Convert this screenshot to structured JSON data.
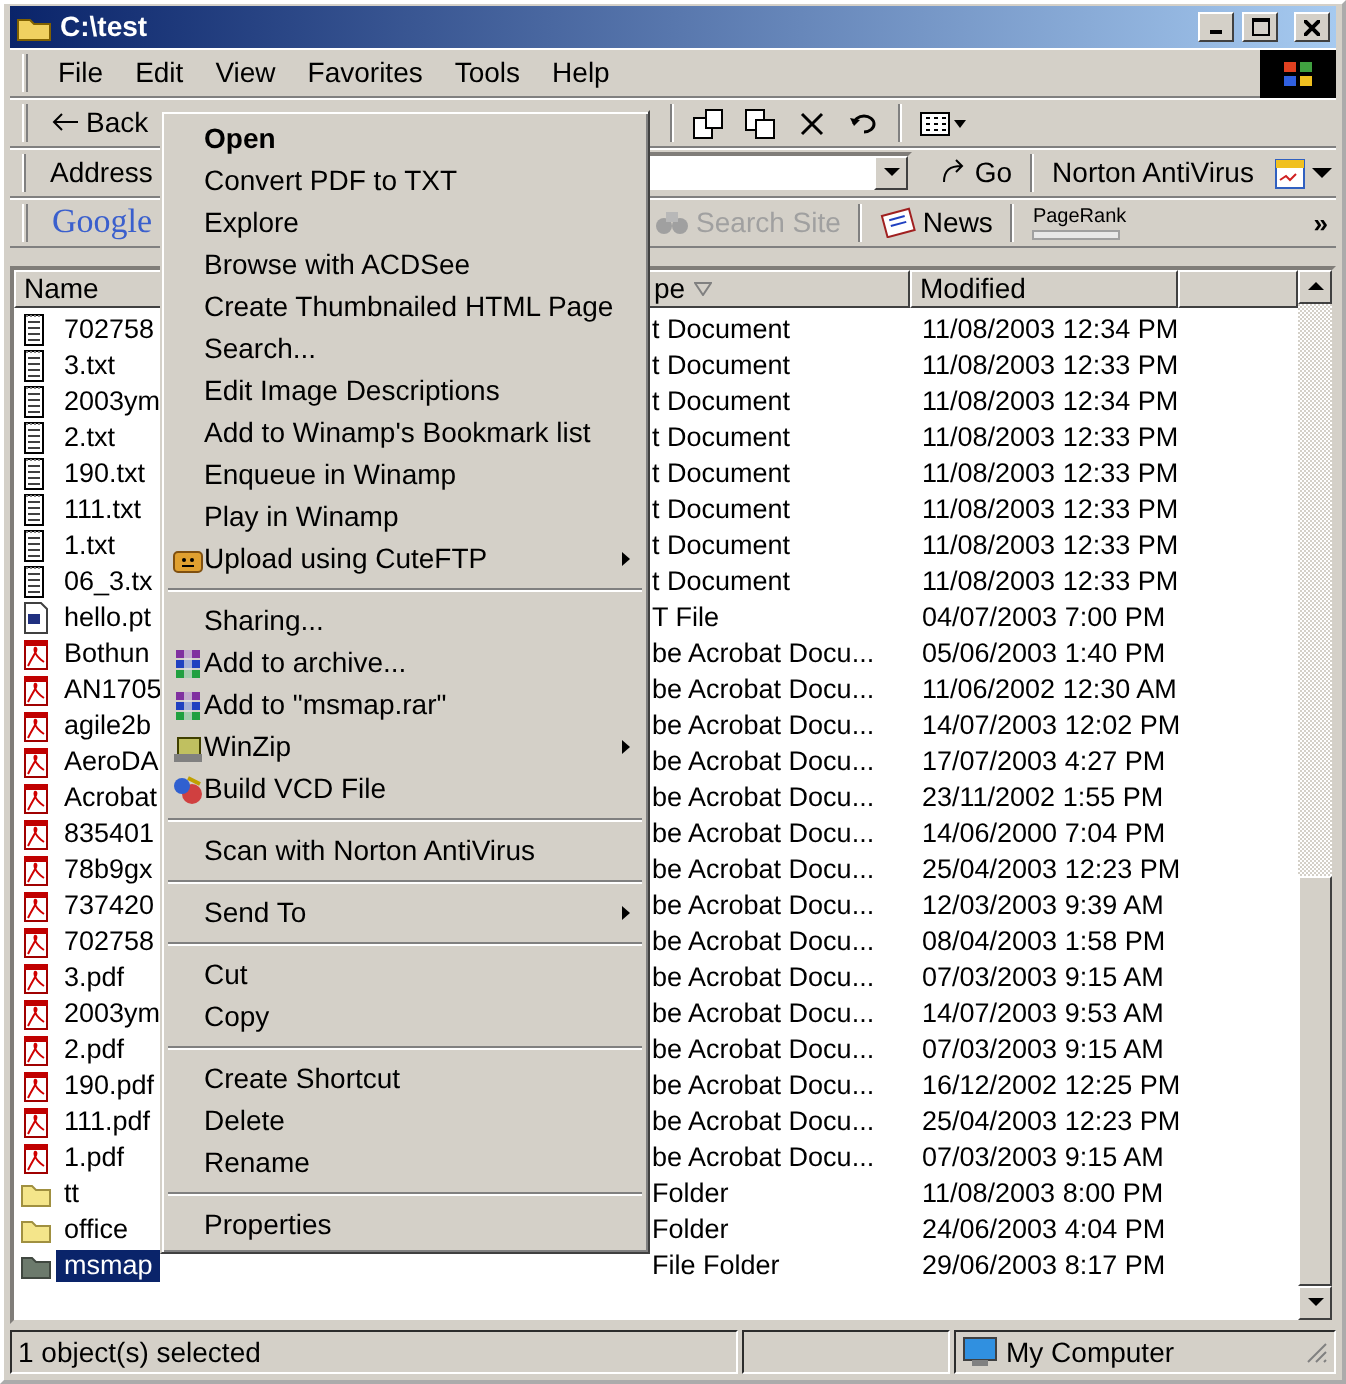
{
  "window": {
    "title": "C:\\test"
  },
  "menu_bar": [
    "File",
    "Edit",
    "View",
    "Favorites",
    "Tools",
    "Help"
  ],
  "toolbar": {
    "back": "Back"
  },
  "address_bar": {
    "label": "Address",
    "go": "Go",
    "norton": "Norton AntiVirus"
  },
  "google_bar": {
    "logo": "Google",
    "search_site": {
      "label": "Search Site",
      "disabled": true
    },
    "news": "News",
    "pagerank": "PageRank",
    "more": "»"
  },
  "file_list": {
    "columns": [
      {
        "label": "Name",
        "sorted": false
      },
      {
        "label": "pe",
        "sorted": true
      },
      {
        "label": "Modified",
        "sorted": false
      }
    ],
    "rows": [
      {
        "name": "702758",
        "type": "t Document",
        "modified": "11/08/2003 12:34 PM",
        "kind": "text",
        "selected": false
      },
      {
        "name": "3.txt",
        "type": "t Document",
        "modified": "11/08/2003 12:33 PM",
        "kind": "text",
        "selected": false
      },
      {
        "name": "2003ym",
        "type": "t Document",
        "modified": "11/08/2003 12:34 PM",
        "kind": "text",
        "selected": false
      },
      {
        "name": "2.txt",
        "type": "t Document",
        "modified": "11/08/2003 12:33 PM",
        "kind": "text",
        "selected": false
      },
      {
        "name": "190.txt",
        "type": "t Document",
        "modified": "11/08/2003 12:33 PM",
        "kind": "text",
        "selected": false
      },
      {
        "name": "111.txt",
        "type": "t Document",
        "modified": "11/08/2003 12:33 PM",
        "kind": "text",
        "selected": false
      },
      {
        "name": "1.txt",
        "type": "t Document",
        "modified": "11/08/2003 12:33 PM",
        "kind": "text",
        "selected": false
      },
      {
        "name": "06_3.tx",
        "type": "t Document",
        "modified": "11/08/2003 12:33 PM",
        "kind": "text",
        "selected": false
      },
      {
        "name": "hello.pt",
        "type": "T File",
        "modified": "04/07/2003 7:00 PM",
        "kind": "program",
        "selected": false
      },
      {
        "name": "Bothun",
        "type": "be Acrobat Docu...",
        "modified": "05/06/2003 1:40 PM",
        "kind": "pdf",
        "selected": false
      },
      {
        "name": "AN1705",
        "type": "be Acrobat Docu...",
        "modified": "11/06/2002 12:30 AM",
        "kind": "pdf",
        "selected": false
      },
      {
        "name": "agile2b",
        "type": "be Acrobat Docu...",
        "modified": "14/07/2003 12:02 PM",
        "kind": "pdf",
        "selected": false
      },
      {
        "name": "AeroDA",
        "type": "be Acrobat Docu...",
        "modified": "17/07/2003 4:27 PM",
        "kind": "pdf",
        "selected": false
      },
      {
        "name": "Acrobat",
        "type": "be Acrobat Docu...",
        "modified": "23/11/2002 1:55 PM",
        "kind": "pdf",
        "selected": false
      },
      {
        "name": "835401",
        "type": "be Acrobat Docu...",
        "modified": "14/06/2000 7:04 PM",
        "kind": "pdf",
        "selected": false
      },
      {
        "name": "78b9gx",
        "type": "be Acrobat Docu...",
        "modified": "25/04/2003 12:23 PM",
        "kind": "pdf",
        "selected": false
      },
      {
        "name": "737420",
        "type": "be Acrobat Docu...",
        "modified": "12/03/2003 9:39 AM",
        "kind": "pdf",
        "selected": false
      },
      {
        "name": "702758",
        "type": "be Acrobat Docu...",
        "modified": "08/04/2003 1:58 PM",
        "kind": "pdf",
        "selected": false
      },
      {
        "name": "3.pdf",
        "type": "be Acrobat Docu...",
        "modified": "07/03/2003 9:15 AM",
        "kind": "pdf",
        "selected": false
      },
      {
        "name": "2003ym",
        "type": "be Acrobat Docu...",
        "modified": "14/07/2003 9:53 AM",
        "kind": "pdf",
        "selected": false
      },
      {
        "name": "2.pdf",
        "type": "be Acrobat Docu...",
        "modified": "07/03/2003 9:15 AM",
        "kind": "pdf",
        "selected": false
      },
      {
        "name": "190.pdf",
        "type": "be Acrobat Docu...",
        "modified": "16/12/2002 12:25 PM",
        "kind": "pdf",
        "selected": false
      },
      {
        "name": "111.pdf",
        "type": "be Acrobat Docu...",
        "modified": "25/04/2003 12:23 PM",
        "kind": "pdf",
        "selected": false
      },
      {
        "name": "1.pdf",
        "type": "be Acrobat Docu...",
        "modified": "07/03/2003 9:15 AM",
        "kind": "pdf",
        "selected": false
      },
      {
        "name": "tt",
        "type": "Folder",
        "modified": "11/08/2003 8:00 PM",
        "kind": "folder",
        "selected": false
      },
      {
        "name": "office",
        "type": "Folder",
        "modified": "24/06/2003 4:04 PM",
        "kind": "folder",
        "selected": false
      },
      {
        "name": "msmap",
        "type": "File Folder",
        "modified": "29/06/2003 8:17 PM",
        "kind": "folder",
        "selected": true
      }
    ]
  },
  "context_menu": [
    {
      "kind": "item",
      "label": "Open",
      "default": true
    },
    {
      "kind": "item",
      "label": "Convert PDF to TXT",
      "default": false
    },
    {
      "kind": "item",
      "label": "Explore",
      "default": false
    },
    {
      "kind": "item",
      "label": "Browse with ACDSee",
      "default": false
    },
    {
      "kind": "item",
      "label": "Create Thumbnailed HTML Page",
      "default": false
    },
    {
      "kind": "item",
      "label": "Search...",
      "default": false
    },
    {
      "kind": "item",
      "label": "Edit Image Descriptions",
      "default": false
    },
    {
      "kind": "item",
      "label": "Add to Winamp's Bookmark list",
      "default": false
    },
    {
      "kind": "item",
      "label": "Enqueue in Winamp",
      "default": false
    },
    {
      "kind": "item",
      "label": "Play in Winamp",
      "default": false
    },
    {
      "kind": "ftp",
      "label": "Upload using CuteFTP",
      "default": false,
      "submenu": true
    },
    {
      "kind": "separator"
    },
    {
      "kind": "item",
      "label": "Sharing...",
      "default": false
    },
    {
      "kind": "archive",
      "label": "Add to archive...",
      "default": false
    },
    {
      "kind": "archive",
      "label": "Add to \"msmap.rar\"",
      "default": false
    },
    {
      "kind": "zip",
      "label": "WinZip",
      "default": false,
      "submenu": true
    },
    {
      "kind": "vcd",
      "label": "Build VCD File",
      "default": false
    },
    {
      "kind": "separator"
    },
    {
      "kind": "item",
      "label": "Scan with Norton AntiVirus",
      "default": false
    },
    {
      "kind": "separator"
    },
    {
      "kind": "item",
      "label": "Send To",
      "default": false,
      "submenu": true
    },
    {
      "kind": "separator"
    },
    {
      "kind": "item",
      "label": "Cut",
      "default": false
    },
    {
      "kind": "item",
      "label": "Copy",
      "default": false
    },
    {
      "kind": "separator"
    },
    {
      "kind": "item",
      "label": "Create Shortcut",
      "default": false
    },
    {
      "kind": "item",
      "label": "Delete",
      "default": false
    },
    {
      "kind": "item",
      "label": "Rename",
      "default": false
    },
    {
      "kind": "separator"
    },
    {
      "kind": "item",
      "label": "Properties",
      "default": false
    }
  ],
  "status_bar": {
    "selection": "1 object(s) selected",
    "zone": "My Computer"
  }
}
